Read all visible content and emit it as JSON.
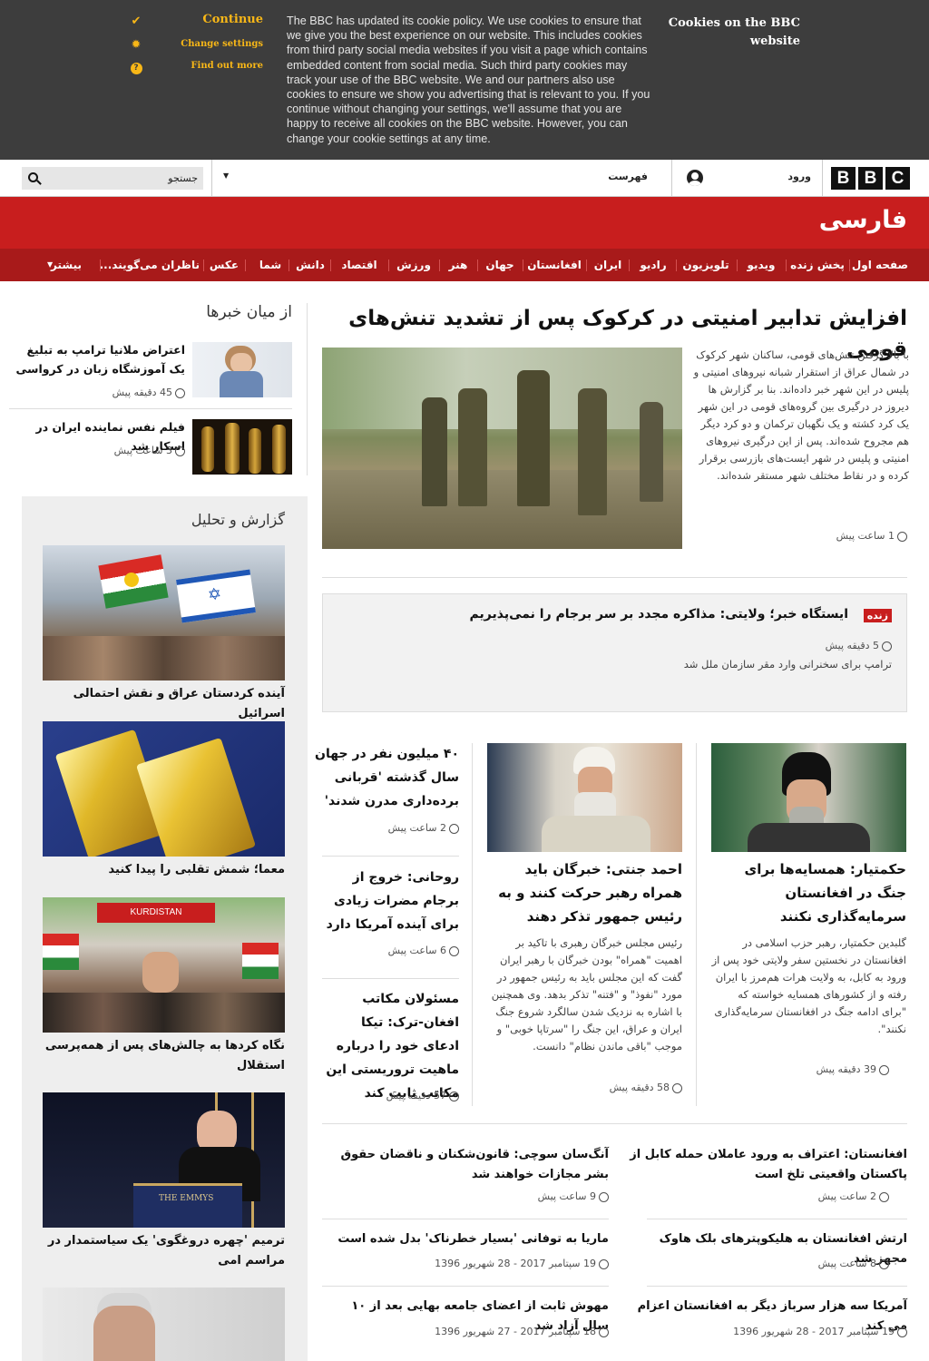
{
  "cookie_banner": {
    "title": "Cookies on the BBC website",
    "continue_label": "Continue",
    "change_settings_label": "Change settings",
    "find_out_more_label": "Find out more",
    "text": "The BBC has updated its cookie policy. We use cookies to ensure that we give you the best experience on our website. This includes cookies from third party social media websites if you visit a page which contains embedded content from social media. Such third party cookies may track your use of the BBC website. We and our partners also use cookies to ensure we show you advertising that is relevant to you. If you continue without changing your settings, we'll assume that you are happy to receive all cookies on the BBC website. However, you can change your cookie settings at any time."
  },
  "topbar": {
    "brand_letters": [
      "B",
      "B",
      "C"
    ],
    "signin_label": "ورود",
    "menu_label": "فهرست",
    "search_placeholder": "جستجو"
  },
  "site": {
    "title": "فارسی"
  },
  "nav": {
    "items": [
      "صفحه اول",
      "پخش زنده",
      "ویدیو",
      "تلویزیون",
      "رادیو",
      "ایران",
      "افغانستان",
      "جهان",
      "هنر",
      "ورزش",
      "اقتصاد",
      "دانش",
      "شما",
      "عکس",
      "ناظران می‌گویند...",
      "بیشتر"
    ]
  },
  "lead": {
    "headline": "افزایش تدابیر امنیتی در کرکوک پس از تشدید تنش‌های قومی",
    "summary": "با بالا گرفتن تنش‌های قومی، ساکنان شهر کرکوک در شمال عراق از استقرار شبانه نیروهای امنیتی و پلیس در این شهر خبر داده‌اند. بنا بر گزارش ها دیروز در درگیری بین گروه‌های قومی در این شهر یک کرد کشته و یک نگهبان ترکمان و دو کرد دیگر هم مجروح شده‌اند. پس از این درگیری نیروهای امنیتی و پلیس در شهر ایست‌های بازرسی برقرار کرده و در نقاط مختلف شهر مستقر شده‌اند.",
    "time": "1 ساعت پیش"
  },
  "live": {
    "badge": "زنده",
    "headline": "ایستگاه خبر؛ ولایتی: مذاکره مجدد بر سر برجام را نمی‌پذیریم",
    "time": "5 دقیقه پیش",
    "sub": "ترامپ برای سخنرانی وارد مقر سازمان ملل شد"
  },
  "stories": [
    {
      "headline": "حکمتیار: همسایه‌ها برای جنگ در افغانستان سرمایه‌گذاری نکنند",
      "summary": "گلبدین حکمتیار، رهبر حزب اسلامی در افغانستان در نخستین سفر ولایتی خود پس از ورود به کابل، به ولایت هرات هم‌مرز با ایران رفته و از کشورهای همسایه خواسته که \"برای ادامه جنگ در افغانستان سرمایه‌گذاری نکنند\".",
      "time": "39 دقیقه پیش"
    },
    {
      "headline": "احمد جنتی: خبرگان باید همراه رهبر حرکت کنند و به رئیس جمهور تذکر دهند",
      "summary": "رئیس مجلس خبرگان رهبری با تاکید بر اهمیت \"همراه\" بودن خبرگان با رهبر ایران گفت که این مجلس باید به رئیس جمهور در مورد \"نفوذ\" و \"فتنه\" تذکر بدهد. وی همچنین با اشاره به نزدیک شدن سالگرد شروع جنگ ایران و عراق، این جنگ را \"سرتاپا خوبی\" و موجب \"باقی ماندن نظام\" دانست.",
      "time": "58 دقیقه پیش"
    }
  ],
  "small_stories": [
    {
      "headline": "۴۰ میلیون نفر در جهان سال گذشته 'قربانی برده‌داری مدرن شدند'",
      "time": "2 ساعت پیش"
    },
    {
      "headline": "روحانی: خروج از برجام مضرات زیادی برای آینده آمریکا دارد",
      "time": "6 ساعت پیش"
    },
    {
      "headline": "مسئولان مکاتب افغان-ترک: تیکا ادعای خود را درباره ماهیت تروریستی این مکاتب ثابت کند",
      "time": "57 دقیقه پیش"
    }
  ],
  "list_right": [
    {
      "headline": "افغانستان: اعتراف به ورود عاملان حمله کابل از پاکستان واقعیتی تلخ است",
      "time": "2 ساعت پیش"
    },
    {
      "headline": "ارتش افغانستان به هلیکوپترهای بلک هاوک مجهز شد",
      "time": "8 ساعت پیش"
    },
    {
      "headline": "آمریکا سه هزار سرباز دیگر به افغانستان اعزام می کند",
      "time": "19 سپتامبر 2017 - 28 شهریور 1396"
    }
  ],
  "list_left": [
    {
      "headline": "آنگ‌سان سوچی: قانون‌شکنان و ناقضان حقوق بشر مجازات خواهند شد",
      "time": "9 ساعت پیش"
    },
    {
      "headline": "ماریا به توفانی 'بسیار خطرناک' بدل شده است",
      "time": "19 سپتامبر 2017 - 28 شهریور 1396"
    },
    {
      "headline": "مهوش ثابت از اعضای جامعه بهایی بعد از ۱۰ سال آزاد شد",
      "time": "18 سپتامبر 2017 - 27 شهریور 1396"
    }
  ],
  "sidebar": {
    "heading": "از میان خبرها",
    "items": [
      {
        "headline": "اعتراض ملانیا ترامپ به تبلیغ یک آموزشگاه زبان در کرواسی",
        "time": "45 دقیقه پیش"
      },
      {
        "headline": "فیلم نفس نماینده ایران در اسکار شد",
        "time": "3 ساعت پیش"
      }
    ]
  },
  "analysis": {
    "heading": "گزارش و تحلیل",
    "items": [
      {
        "headline": "آینده کردستان عراق و نقش احتمالی اسرائیل"
      },
      {
        "headline": "معما؛ شمش تقلبی را پیدا کنید"
      },
      {
        "headline": "نگاه کردها به چالش‌های پس از همه‌پرسی استقلال"
      },
      {
        "headline": "ترمیم 'چهره دروغگوی' یک سیاستمدار در مراسم امی"
      }
    ]
  },
  "colors": {
    "brand_red": "#c81e1e",
    "nav_red": "#a81a1a",
    "cookie_bg": "#3d3d3d",
    "cookie_accent": "#f8b717",
    "live_badge": "#c81e1e"
  }
}
